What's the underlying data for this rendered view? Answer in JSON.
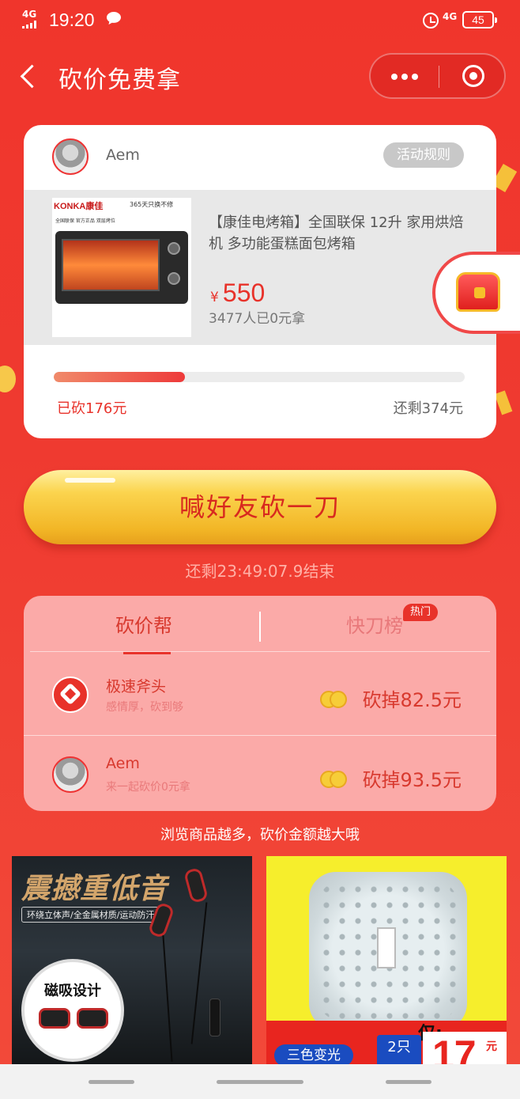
{
  "status": {
    "network": "4G",
    "time": "19:20",
    "network_right": "4G",
    "battery": "45"
  },
  "nav": {
    "title": "砍价免费拿"
  },
  "card": {
    "user_name": "Aem",
    "rules_label": "活动规则",
    "product": {
      "image_brand": "KONKA康佳",
      "image_slogan": "365天只换不修",
      "image_tags": "全国联保   官方正品   双层烤位",
      "title": "【康佳电烤箱】全国联保 12升 家用烘焙机 多功能蛋糕面包烤箱",
      "currency": "¥",
      "price": "550",
      "sold": "3477人已0元拿"
    },
    "progress_fraction": 0.32,
    "cut_done": "已砍176元",
    "cut_left": "还剩374元"
  },
  "cta": {
    "label": "喊好友砍一刀",
    "countdown": "还剩23:49:07.9结束"
  },
  "panel": {
    "tabs": [
      {
        "label": "砍价帮"
      },
      {
        "label": "快刀榜",
        "badge": "热门"
      }
    ],
    "rows": [
      {
        "name": "极速斧头",
        "message": "感情厚，砍到够",
        "amount": "砍掉82.5元"
      },
      {
        "name": "Aem",
        "message": "来一起砍价0元拿",
        "amount": "砍掉93.5元"
      }
    ]
  },
  "browse_hint": "浏览商品越多，砍价金额越大哦",
  "recommendations": [
    {
      "title": "震撼重低音",
      "subtitle": "环绕立体声/全金属材质/运动防汗",
      "badge": "磁吸设计"
    },
    {
      "tag": "三色变光",
      "only": "仅:",
      "qty": "2只",
      "price": "17",
      "unit": "元"
    }
  ],
  "colors": {
    "brand_red": "#f0352c",
    "price_red": "#e8322a",
    "button_gold": "#f2b626"
  }
}
